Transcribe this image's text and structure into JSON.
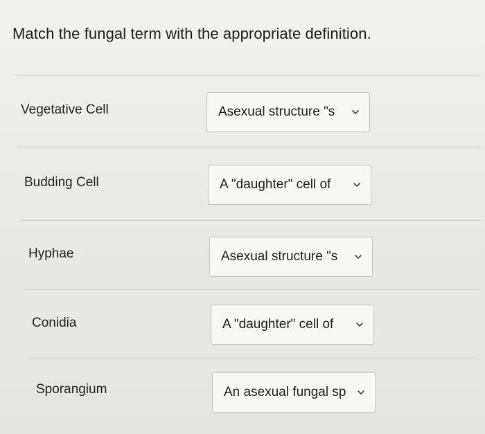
{
  "question": {
    "prompt": "Match the fungal term with the appropriate definition."
  },
  "rows": [
    {
      "term": "Vegetative Cell",
      "selected": "Asexual structure \"s"
    },
    {
      "term": "Budding Cell",
      "selected": "A \"daughter\" cell of"
    },
    {
      "term": "Hyphae",
      "selected": "Asexual structure \"s"
    },
    {
      "term": "Conidia",
      "selected": "A \"daughter\" cell of"
    },
    {
      "term": "Sporangium",
      "selected": "An asexual fungal sp"
    }
  ],
  "icons": {
    "dropdown": "chevron-down-icon"
  }
}
